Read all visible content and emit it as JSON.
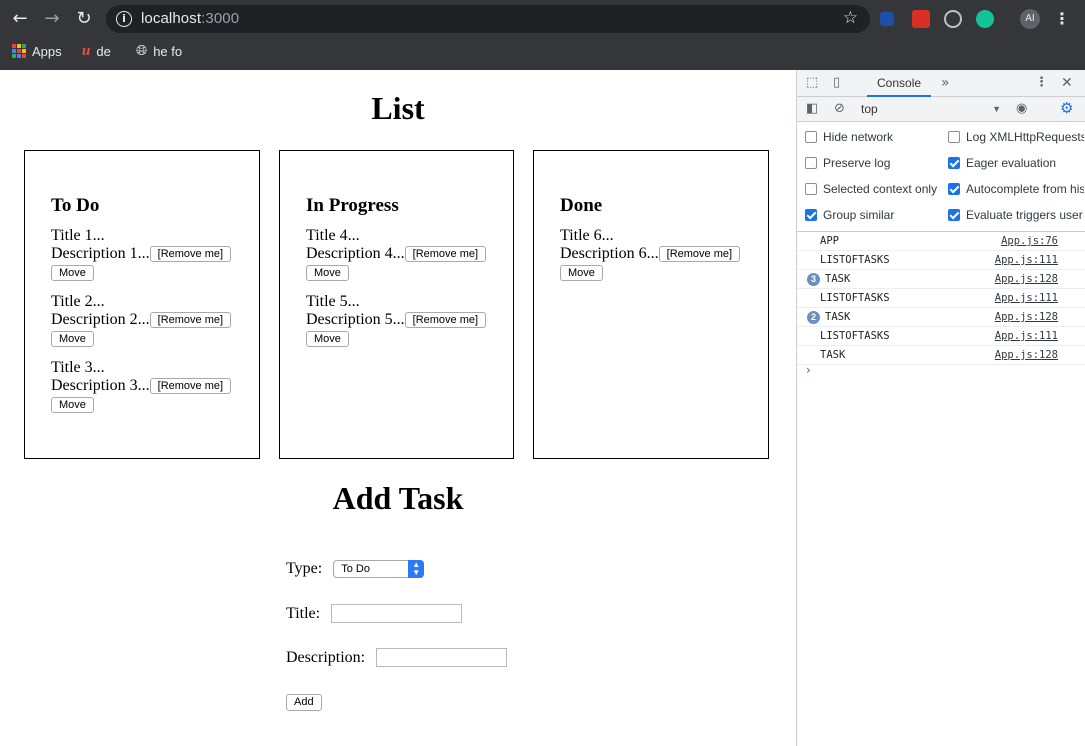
{
  "browser": {
    "url_host": "localhost",
    "url_port": ":3000",
    "avatar_initials": "AI",
    "bookmarks": [
      {
        "label": "Apps"
      },
      {
        "label": "de"
      },
      {
        "label": "he fo"
      }
    ]
  },
  "page": {
    "title": "List",
    "columns": [
      {
        "heading": "To Do",
        "tasks": [
          {
            "title": "Title 1...",
            "description": "Description 1...",
            "remove_label": "[Remove me]",
            "move_label": "Move"
          },
          {
            "title": "Title 2...",
            "description": "Description 2...",
            "remove_label": "[Remove me]",
            "move_label": "Move"
          },
          {
            "title": "Title 3...",
            "description": "Description 3...",
            "remove_label": "[Remove me]",
            "move_label": "Move"
          }
        ]
      },
      {
        "heading": "In Progress",
        "tasks": [
          {
            "title": "Title 4...",
            "description": "Description 4...",
            "remove_label": "[Remove me]",
            "move_label": "Move"
          },
          {
            "title": "Title 5...",
            "description": "Description 5...",
            "remove_label": "[Remove me]",
            "move_label": "Move"
          }
        ]
      },
      {
        "heading": "Done",
        "tasks": [
          {
            "title": "Title 6...",
            "description": "Description 6...",
            "remove_label": "[Remove me]",
            "move_label": "Move"
          }
        ]
      }
    ],
    "add_task": {
      "title": "Add Task",
      "type_label": "Type:",
      "type_value": "To Do",
      "title_label": "Title:",
      "title_value": "",
      "description_label": "Description:",
      "description_value": "",
      "add_label": "Add"
    }
  },
  "devtools": {
    "tab_label": "Console",
    "context": "top",
    "settings": [
      {
        "label": "Hide network",
        "checked": false
      },
      {
        "label": "Log XMLHttpRequests",
        "checked": false
      },
      {
        "label": "Preserve log",
        "checked": false
      },
      {
        "label": "Eager evaluation",
        "checked": true
      },
      {
        "label": "Selected context only",
        "checked": false
      },
      {
        "label": "Autocomplete from history",
        "checked": true
      },
      {
        "label": "Group similar",
        "checked": true
      },
      {
        "label": "Evaluate triggers user activation",
        "checked": true
      }
    ],
    "log": [
      {
        "message": "APP",
        "source": "App.js:76",
        "count": ""
      },
      {
        "message": "LISTOFTASKS",
        "source": "App.js:111",
        "count": ""
      },
      {
        "message": "TASK",
        "source": "App.js:128",
        "count": "3"
      },
      {
        "message": "LISTOFTASKS",
        "source": "App.js:111",
        "count": ""
      },
      {
        "message": "TASK",
        "source": "App.js:128",
        "count": "2"
      },
      {
        "message": "LISTOFTASKS",
        "source": "App.js:111",
        "count": ""
      },
      {
        "message": "TASK",
        "source": "App.js:128",
        "count": ""
      }
    ],
    "prompt_symbol": "›"
  },
  "colors": {
    "chrome_bg": "#35363a",
    "omnibox_bg": "#202124",
    "devtools_accent": "#1a73e8",
    "select_caret": "#2a7bf6"
  }
}
